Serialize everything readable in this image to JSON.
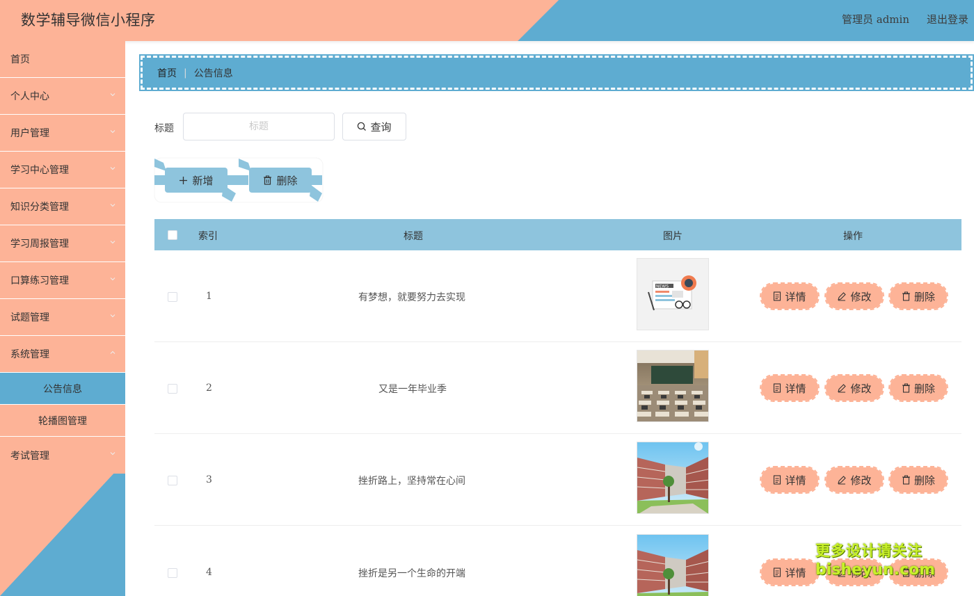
{
  "header": {
    "app_title": "数学辅导微信小程序",
    "admin_label": "管理员 admin",
    "logout_label": "退出登录"
  },
  "sidebar": {
    "items": [
      {
        "label": "首页"
      },
      {
        "label": "个人中心"
      },
      {
        "label": "用户管理"
      },
      {
        "label": "学习中心管理"
      },
      {
        "label": "知识分类管理"
      },
      {
        "label": "学习周报管理"
      },
      {
        "label": "口算练习管理"
      },
      {
        "label": "试题管理"
      },
      {
        "label": "系统管理"
      }
    ],
    "sub_items": [
      {
        "label": "公告信息",
        "active": true
      },
      {
        "label": "轮播图管理",
        "active": false
      }
    ],
    "last_item": {
      "label": "考试管理"
    }
  },
  "breadcrumb": {
    "home": "首页",
    "separator": "|",
    "current": "公告信息"
  },
  "search": {
    "label": "标题",
    "placeholder": "标题",
    "button_label": "查询"
  },
  "actions": {
    "add_label": "新增",
    "delete_label": "删除"
  },
  "table": {
    "columns": [
      "索引",
      "标题",
      "图片",
      "操作"
    ],
    "rows": [
      {
        "index": "1",
        "title": "有梦想，就要努力去实现",
        "image": "news"
      },
      {
        "index": "2",
        "title": "又是一年毕业季",
        "image": "classroom"
      },
      {
        "index": "3",
        "title": "挫折路上，坚持常在心间",
        "image": "campus"
      },
      {
        "index": "4",
        "title": "挫折是另一个生命的开端",
        "image": "campus"
      }
    ],
    "row_actions": {
      "detail": "详情",
      "edit": "修改",
      "delete": "删除"
    }
  },
  "watermark": {
    "line1": "更多设计请关注",
    "line2": "bisheyun.com"
  },
  "colors": {
    "peach": "#fdb397",
    "blue": "#5eacd1",
    "light_blue": "#8ec4dd"
  }
}
